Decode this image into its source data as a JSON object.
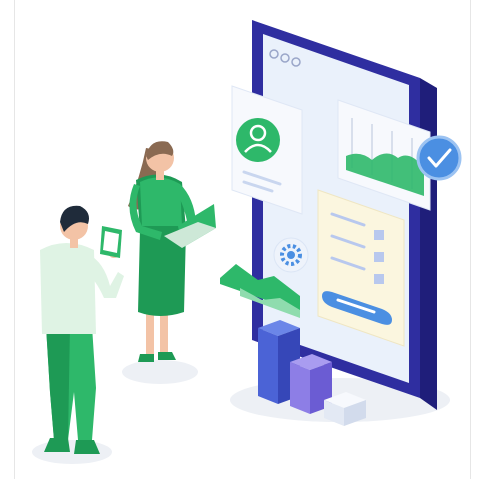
{
  "illustration": {
    "kind": "isometric-ui-illustration",
    "colors": {
      "frame": "#2f2ea0",
      "screen_bg": "#eaf1fb",
      "card_bg": "#f7f9fd",
      "green_dark": "#1e9a55",
      "green": "#2eb86a",
      "green_light": "#8fdcae",
      "blue": "#4b8fe2",
      "blue_light": "#9cc3f2",
      "purple": "#4d3fc8",
      "purple_light": "#8d7ee6",
      "skin": "#f3c3a6",
      "hair_woman": "#8a6a52",
      "hair_man": "#1f2b3a",
      "shirt_man": "#dff3e4",
      "floor": "#edf0f5",
      "accent_cream": "#fbf6df"
    },
    "icons": [
      "profile-icon",
      "settings-gear-icon",
      "checkmark-icon",
      "area-chart-icon",
      "bar-chart-icon",
      "smartphone-icon",
      "laptop-icon"
    ]
  }
}
